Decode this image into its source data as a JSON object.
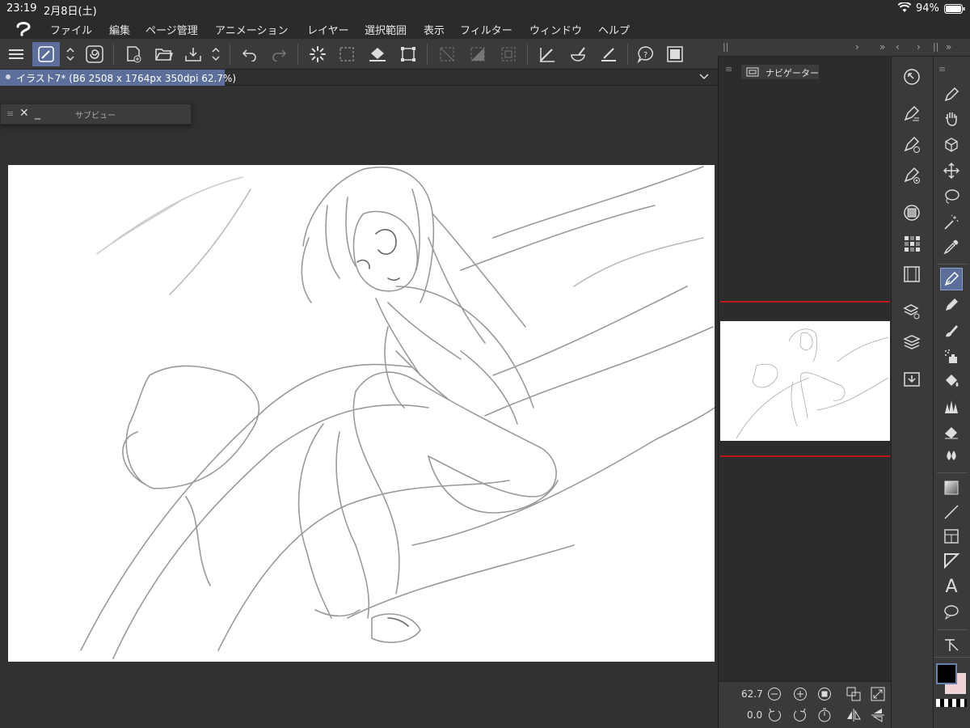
{
  "status": {
    "time": "23:19",
    "date": "2月8日(土)",
    "battery": "94%"
  },
  "menu": [
    "ファイル",
    "編集",
    "ページ管理",
    "アニメーション",
    "レイヤー",
    "選択範囲",
    "表示",
    "フィルター",
    "ウィンドウ",
    "ヘルプ"
  ],
  "document_tab": {
    "label": "イラスト7* (B6 2508 x 1764px 350dpi 62.7%)"
  },
  "subview": {
    "title": "サブビュー"
  },
  "navigator": {
    "tab_label": "ナビゲーター",
    "zoom": "62.7",
    "rotation": "0.0"
  },
  "colors": {
    "main": "#000000",
    "sub": "#f2d3d3",
    "accent": "#5b6f9a"
  }
}
